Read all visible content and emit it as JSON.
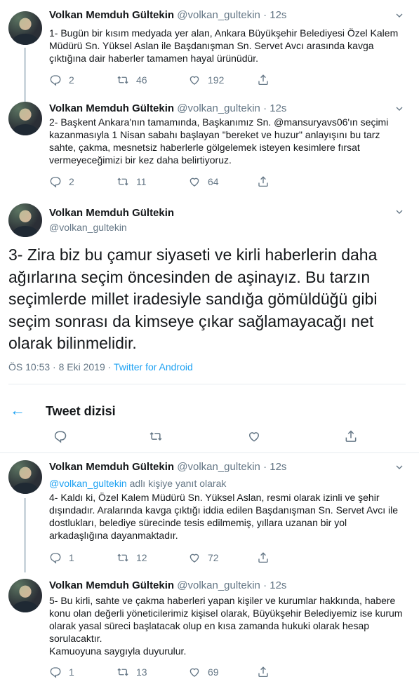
{
  "tweets_above": [
    {
      "name": "Volkan Memduh Gültekin",
      "handle": "@volkan_gultekin",
      "time": "12s",
      "text": "1- Bugün bir kısım medyada yer alan, Ankara Büyükşehir Belediyesi Özel Kalem Müdürü Sn. Yüksel Aslan ile Başdanışman Sn. Servet Avcı arasında kavga çıktığına dair haberler tamamen hayal ürünüdür.",
      "replies": "2",
      "retweets": "46",
      "likes": "192"
    },
    {
      "name": "Volkan Memduh Gültekin",
      "handle": "@volkan_gultekin",
      "time": "12s",
      "text": "2- Başkent Ankara'nın tamamında, Başkanımız Sn. @mansuryavs06'ın seçimi kazanmasıyla 1 Nisan sabahı başlayan \"bereket ve huzur\" anlayışını bu tarz sahte, çakma, mesnetsiz haberlerle gölgelemek isteyen kesimlere fırsat vermeyeceğimizi bir kez daha belirtiyoruz.",
      "replies": "2",
      "retweets": "11",
      "likes": "64"
    }
  ],
  "main_tweet": {
    "name": "Volkan Memduh Gültekin",
    "handle": "@volkan_gultekin",
    "text": "3- Zira biz bu çamur siyaseti ve kirli haberlerin daha ağırlarına seçim öncesinden de aşinayız. Bu tarzın seçimlerde millet iradesiyle sandığa gömüldüğü gibi seçim sonrası da kimseye çıkar sağlamayacağı net olarak bilinmelidir.",
    "timestamp": "ÖS 10:53 · 8 Eki 2019 · ",
    "source": "Twitter for Android"
  },
  "thread_header": {
    "title": "Tweet dizisi"
  },
  "tweets_below": [
    {
      "name": "Volkan Memduh Gültekin",
      "handle": "@volkan_gultekin",
      "time": "12s",
      "reply_handle": "@volkan_gultekin",
      "reply_suffix": " adlı kişiye yanıt olarak",
      "text": "4- Kaldı ki, Özel Kalem Müdürü Sn. Yüksel Aslan, resmi olarak izinli ve şehir dışındadır. Aralarında kavga çıktığı iddia edilen Başdanışman Sn. Servet Avcı ile dostlukları, belediye sürecinde tesis edilmemiş, yıllara uzanan bir yol arkadaşlığına dayanmaktadır.",
      "replies": "1",
      "retweets": "12",
      "likes": "72"
    },
    {
      "name": "Volkan Memduh Gültekin",
      "handle": "@volkan_gultekin",
      "time": "12s",
      "text": "5- Bu kirli, sahte ve çakma haberleri yapan kişiler ve kurumlar hakkında, habere konu olan değerli yöneticilerimiz kişisel olarak, Büyükşehir Belediyemiz ise kurum olarak yasal süreci başlatacak olup en kısa zamanda hukuki olarak hesap sorulacaktır.\nKamuoyuna saygıyla duyurulur.",
      "replies": "1",
      "retweets": "13",
      "likes": "69"
    }
  ],
  "icons": {
    "reply": "reply-icon",
    "retweet": "retweet-icon",
    "like": "heart-icon",
    "share": "share-icon",
    "caret": "chevron-down-icon",
    "back": "back-arrow-icon"
  },
  "colors": {
    "accent": "#1da1f2",
    "secondary_text": "#657786",
    "divider": "#e6ecf0"
  }
}
